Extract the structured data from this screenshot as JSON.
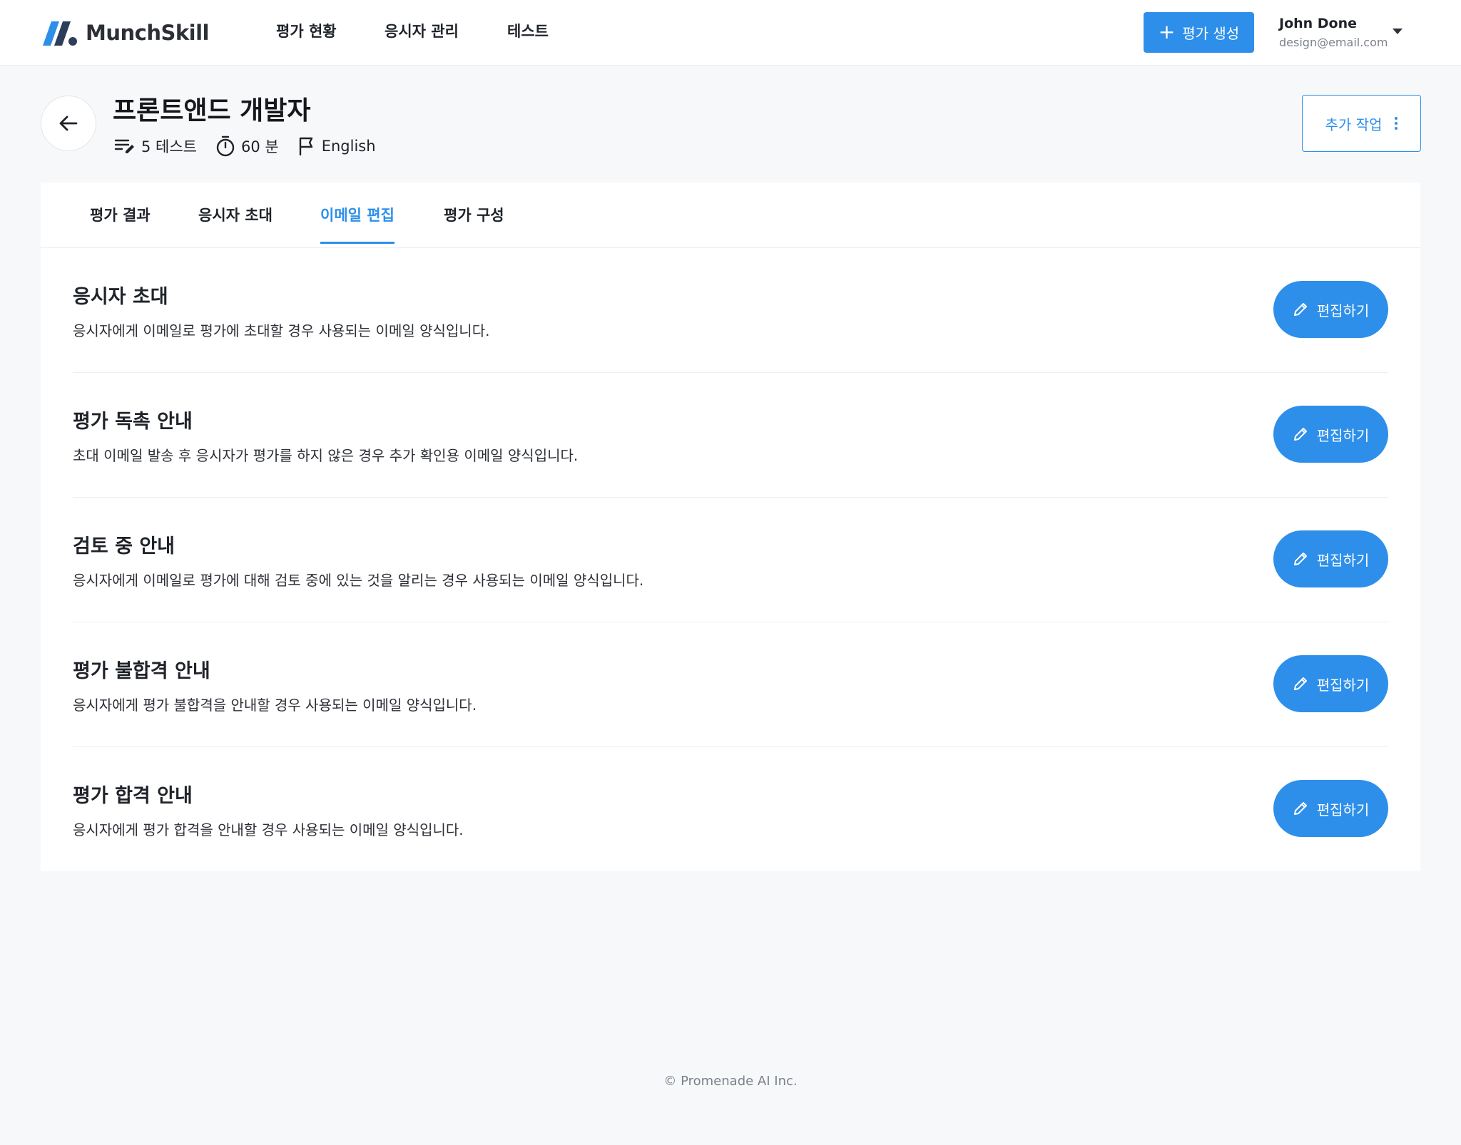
{
  "brand": {
    "name": "MunchSkill",
    "accent": "#2d8fea"
  },
  "nav": {
    "items": [
      {
        "label": "평가 현황"
      },
      {
        "label": "응시자 관리"
      },
      {
        "label": "테스트"
      }
    ],
    "create_label": "평가 생성",
    "create_icon": "plus-icon"
  },
  "user": {
    "name": "John Done",
    "email": "design@email.com"
  },
  "header": {
    "title": "프론트앤드 개발자",
    "tests": "5 테스트",
    "duration": "60 분",
    "language": "English",
    "more_label": "추가 작업"
  },
  "tabs": [
    {
      "label": "평가 결과"
    },
    {
      "label": "응시자 초대"
    },
    {
      "label": "이메일 편집",
      "active": true
    },
    {
      "label": "평가 구성"
    }
  ],
  "email_templates": [
    {
      "title": "응시자 초대",
      "description": "응시자에게 이메일로 평가에 초대할 경우 사용되는 이메일 양식입니다.",
      "button": "편집하기"
    },
    {
      "title": "평가 독촉 안내",
      "description": "초대 이메일 발송 후 응시자가 평가를 하지 않은 경우 추가 확인용 이메일 양식입니다.",
      "button": "편집하기"
    },
    {
      "title": "검토 중 안내",
      "description": "응시자에게 이메일로 평가에 대해 검토 중에 있는 것을 알리는 경우 사용되는 이메일 양식입니다.",
      "button": "편집하기"
    },
    {
      "title": "평가 불합격 안내",
      "description": "응시자에게 평가 불합격을 안내할 경우 사용되는 이메일 양식입니다.",
      "button": "편집하기"
    },
    {
      "title": "평가 합격 안내",
      "description": "응시자에게 평가 합격을 안내할 경우 사용되는 이메일 양식입니다.",
      "button": "편집하기"
    }
  ],
  "footer": {
    "copyright": "© Promenade AI Inc."
  }
}
